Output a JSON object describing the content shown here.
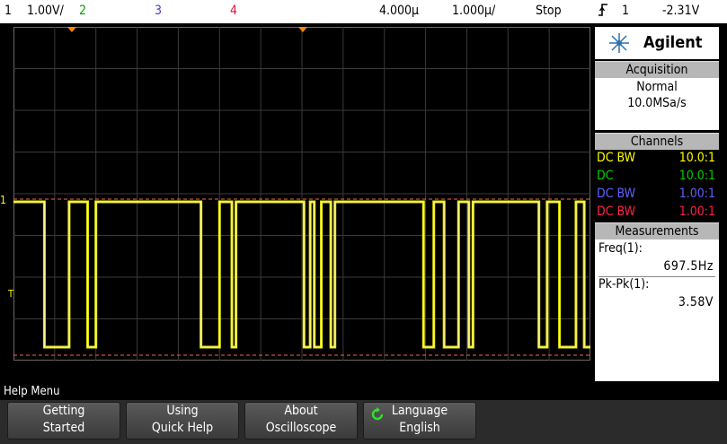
{
  "status_bar": {
    "ch1_num": "1",
    "ch1_scale": "1.00V/",
    "ch2_num": "2",
    "ch3_num": "3",
    "ch4_num": "4",
    "time_delay": "4.000µ",
    "time_scale": "1.000µ/",
    "run_state": "Stop",
    "trigger_icon": "trigger-edge-icon",
    "trigger_source": "1",
    "trigger_level": "-2.31V"
  },
  "colors": {
    "ch1": "#ffff00",
    "ch2": "#00d000",
    "ch3": "#6060ff",
    "ch4": "#ff2050",
    "ref_line": "#ff6060",
    "marker": "#ff8800"
  },
  "brand": {
    "logo_icon": "agilent-spark-icon",
    "name": "Agilent"
  },
  "acquisition": {
    "title": "Acquisition",
    "mode": "Normal",
    "rate": "10.0MSa/s"
  },
  "channels": {
    "title": "Channels",
    "rows": [
      {
        "coupling": "DC BW",
        "probe": "10.0:1"
      },
      {
        "coupling": "DC",
        "probe": "10.0:1"
      },
      {
        "coupling": "DC BW",
        "probe": "1.00:1"
      },
      {
        "coupling": "DC BW",
        "probe": "1.00:1"
      }
    ]
  },
  "measurements": {
    "title": "Measurements",
    "items": [
      {
        "label": "Freq(1):",
        "value": "697.5Hz"
      },
      {
        "label": "Pk-Pk(1):",
        "value": "3.58V"
      }
    ]
  },
  "screen": {
    "ch1_marker": "1",
    "trigger_marker": "T"
  },
  "help_bar": {
    "label": "Help Menu"
  },
  "softkeys": [
    {
      "line1": "Getting",
      "line2": "Started"
    },
    {
      "line1": "Using",
      "line2": "Quick Help"
    },
    {
      "line1": "About",
      "line2": "Oscilloscope"
    },
    {
      "line1": "Language",
      "line2": "English",
      "icon": "cycle-arrow-icon"
    }
  ],
  "waveform": {
    "high_level": "high",
    "low_level": "low",
    "pulses": [
      [
        0.0,
        0.6
      ],
      [
        1.05,
        1.25
      ],
      [
        3.8,
        4.25
      ],
      [
        4.55,
        4.65
      ],
      [
        6.3,
        6.45
      ],
      [
        6.55,
        6.72
      ],
      [
        6.95,
        7.05
      ],
      [
        9.2,
        9.45
      ],
      [
        9.7,
        10.05
      ],
      [
        10.3,
        10.4
      ],
      [
        12.0,
        12.2
      ],
      [
        12.5,
        12.9
      ],
      [
        13.1,
        13.3
      ]
    ],
    "pulse_unit": "time divisions from left edge"
  }
}
